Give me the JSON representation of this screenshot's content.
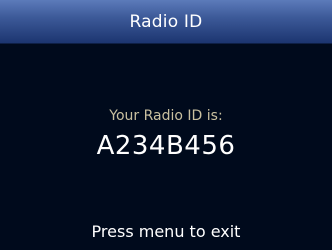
{
  "header": {
    "title": "Radio ID"
  },
  "main": {
    "label": "Your Radio ID is:",
    "radio_id": "A234B456"
  },
  "footer": {
    "hint": "Press menu to exit"
  },
  "colors": {
    "title_bar_top": "#5c7bba",
    "title_bar_bottom": "#1c3570",
    "background": "#000a1c",
    "label_text": "#c9c0a0",
    "primary_text": "#ffffff"
  }
}
